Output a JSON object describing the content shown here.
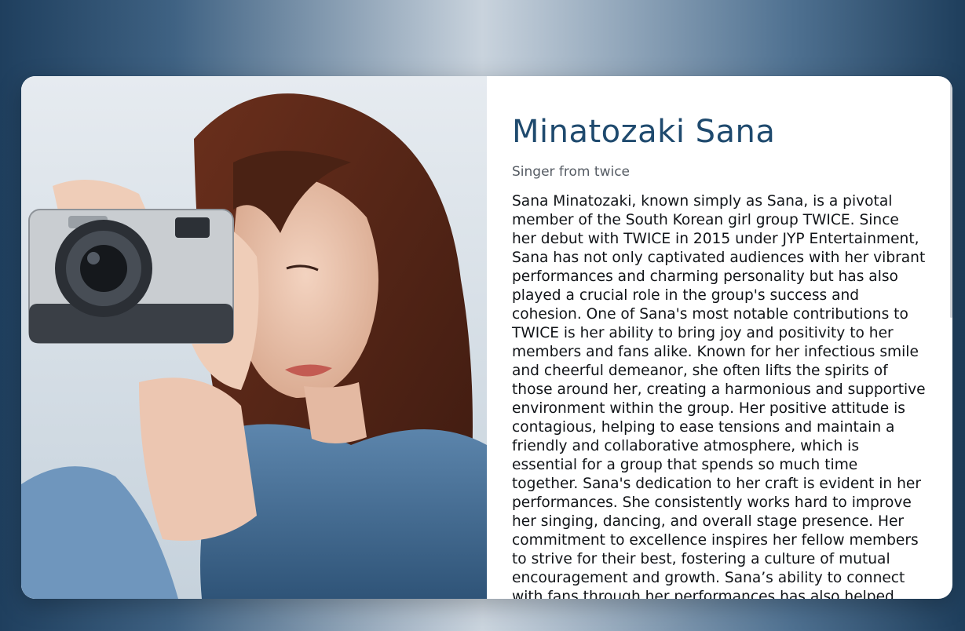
{
  "profile": {
    "name": "Minatozaki Sana",
    "subtitle": "Singer from twice",
    "bio": "Sana Minatozaki, known simply as Sana, is a pivotal member of the South Korean girl group TWICE. Since her debut with TWICE in 2015 under JYP Entertainment, Sana has not only captivated audiences with her vibrant performances and charming personality but has also played a crucial role in the group's success and cohesion. One of Sana's most notable contributions to TWICE is her ability to bring joy and positivity to her members and fans alike. Known for her infectious smile and cheerful demeanor, she often lifts the spirits of those around her, creating a harmonious and supportive environment within the group. Her positive attitude is contagious, helping to ease tensions and maintain a friendly and collaborative atmosphere, which is essential for a group that spends so much time together. Sana's dedication to her craft is evident in her performances. She consistently works hard to improve her singing, dancing, and overall stage presence. Her commitment to excellence inspires her fellow members to strive for their best, fostering a culture of mutual encouragement and growth. Sana’s ability to connect with fans through her performances has also helped"
  },
  "colors": {
    "title": "#1f4a6e",
    "subtitle": "#555b63",
    "body": "#111418"
  }
}
